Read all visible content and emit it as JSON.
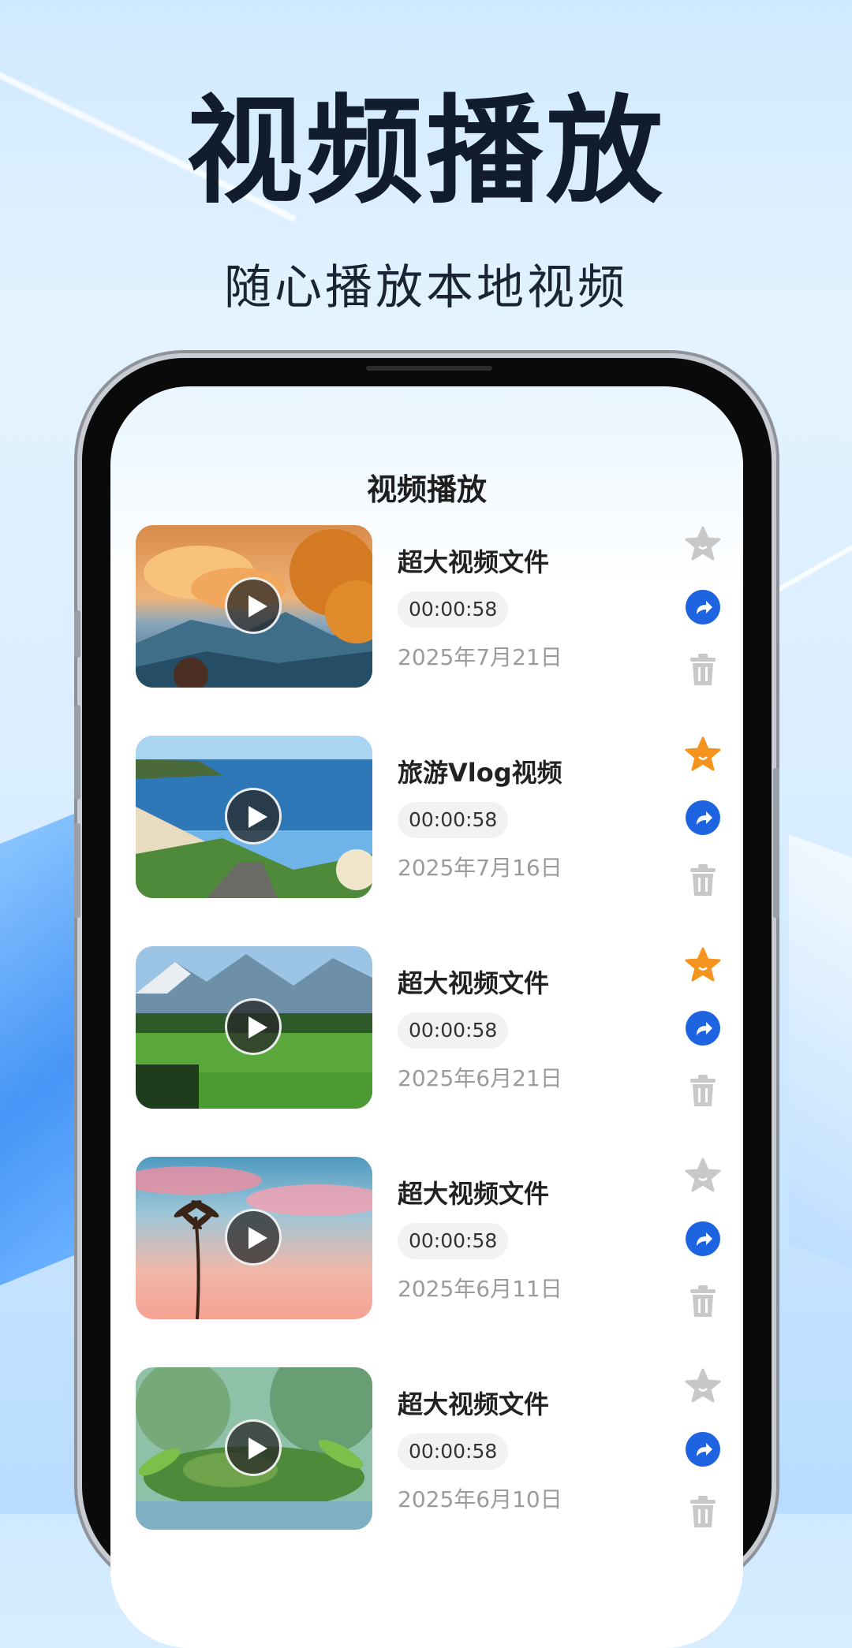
{
  "promo": {
    "headline": "视频播放",
    "subheadline": "随心播放本地视频"
  },
  "screen": {
    "title": "视频播放"
  },
  "videos": [
    {
      "title": "超大视频文件",
      "duration": "00:00:58",
      "date": "2025年7月21日",
      "favorited": false,
      "thumbnail": "autumn-mountain-clouds"
    },
    {
      "title": "旅游Vlog视频",
      "duration": "00:00:58",
      "date": "2025年7月16日",
      "favorited": true,
      "thumbnail": "lake-pampas-grass"
    },
    {
      "title": "超大视频文件",
      "duration": "00:00:58",
      "date": "2025年6月21日",
      "favorited": true,
      "thumbnail": "green-meadow-mountains"
    },
    {
      "title": "超大视频文件",
      "duration": "00:00:58",
      "date": "2025年6月11日",
      "favorited": false,
      "thumbnail": "palm-tree-pink-sky"
    },
    {
      "title": "超大视频文件",
      "duration": "00:00:58",
      "date": "2025年6月10日",
      "favorited": false,
      "thumbnail": "mossy-stone-plants"
    }
  ],
  "icons": {
    "favorite": "star-icon",
    "share": "share-icon",
    "delete": "trash-icon",
    "play": "play-icon"
  },
  "colors": {
    "favorite_active": "#f5931f",
    "favorite_inactive": "#c8c8c8",
    "share": "#1e63e0",
    "delete": "#c8c8c8"
  }
}
